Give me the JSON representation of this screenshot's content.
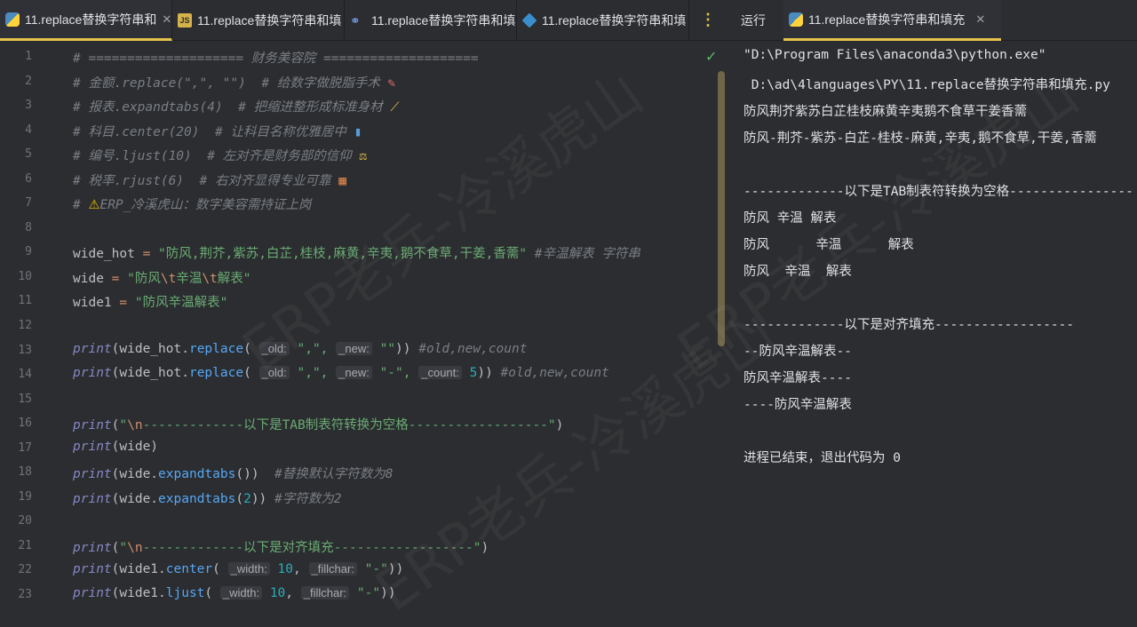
{
  "tabs": [
    {
      "label": "11.replace替换字符串和",
      "icon": "python-file-icon",
      "active": true
    },
    {
      "label": "11.replace替换字符串和填",
      "icon": "js-file-icon",
      "active": false
    },
    {
      "label": "11.replace替换字符串和填",
      "icon": "link-file-icon",
      "active": false
    },
    {
      "label": "11.replace替换字符串和填",
      "icon": "cube-file-icon",
      "active": false
    }
  ],
  "run_panel": {
    "title": "运行",
    "tab_label": "11.replace替换字符串和填充",
    "output": [
      "\"D:\\Program Files\\anaconda3\\python.exe\"",
      " D:\\ad\\4languages\\PY\\11.replace替换字符串和填充.py",
      "防风荆芥紫苏白芷桂枝麻黄辛夷鹅不食草干姜香薷",
      "防风-荆芥-紫苏-白芷-桂枝-麻黄,辛夷,鹅不食草,干姜,香薷",
      "",
      "-------------以下是TAB制表符转换为空格----------------",
      "防风 辛温 解表",
      "防风      辛温      解表",
      "防风  辛温  解表",
      "",
      "-------------以下是对齐填充------------------",
      "--防风辛温解表--",
      "防风辛温解表----",
      "----防风辛温解表",
      "",
      "进程已结束，退出代码为 0"
    ]
  },
  "editor": {
    "line_numbers": [
      "1",
      "2",
      "3",
      "4",
      "5",
      "6",
      "7",
      "8",
      "9",
      "10",
      "11",
      "12",
      "13",
      "14",
      "15",
      "16",
      "17",
      "18",
      "19",
      "20",
      "21",
      "22",
      "23"
    ],
    "comments": {
      "l1": "# ==================== 财务美容院 ====================",
      "l2": "# 金额.replace(\",\", \"\")  # 给数字做脱脂手术 ",
      "l3": "# 报表.expandtabs(4)  # 把缩进整形成标准身材 ",
      "l4": "# 科目.center(20)  # 让科目名称优雅居中 ",
      "l5": "# 编号.ljust(10)  # 左对齐是财务部的信仰 ",
      "l6": "# 税率.rjust(6)  # 右对齐显得专业可靠 ",
      "l7_prefix": "# ",
      "l7_text": "ERP_冷溪虎山：数字美容需持证上岗"
    },
    "l9": {
      "var": "wide_hot",
      "op": " = ",
      "str": "\"防风,荆芥,紫苏,白芷,桂枝,麻黄,辛夷,鹅不食草,干姜,香薷\"",
      "comment": " #辛温解表 字符串"
    },
    "l10": {
      "var": "wide",
      "op": " = ",
      "s1": "\"防风",
      "e1": "\\t",
      "s2": "辛温",
      "e2": "\\t",
      "s3": "解表\""
    },
    "l11": {
      "var": "wide1",
      "op": " = ",
      "str": "\"防风辛温解表\""
    },
    "l13": {
      "print": "print",
      "open": "(wide_hot.",
      "fn": "replace",
      "p": "( ",
      "h_old": "_old:",
      "a1": " \",\", ",
      "h_new": "_new:",
      "a2": " \"\"",
      "close": "))",
      "comment": " #old,new,count"
    },
    "l14": {
      "print": "print",
      "open": "(wide_hot.",
      "fn": "replace",
      "p": "( ",
      "h_old": "_old:",
      "a1": " \",\", ",
      "h_new": "_new:",
      "a2": " \"-\", ",
      "h_count": "_count:",
      "num": " 5",
      "close": "))",
      "comment": " #old,new,count"
    },
    "l16": {
      "print": "print",
      "p": "(",
      "s1": "\"",
      "esc": "\\n",
      "s2": "-------------以下是TAB制表符转换为空格------------------\"",
      "close": ")"
    },
    "l17": {
      "print": "print",
      "rest": "(wide)"
    },
    "l18": {
      "print": "print",
      "open": "(wide.",
      "fn": "expandtabs",
      "close": "())",
      "comment": "  #替换默认字符数为8"
    },
    "l19": {
      "print": "print",
      "open": "(wide.",
      "fn": "expandtabs",
      "p": "(",
      "num": "2",
      "close": "))",
      "comment": " #字符数为2"
    },
    "l21": {
      "print": "print",
      "p": "(",
      "s1": "\"",
      "esc": "\\n",
      "s2": "-------------以下是对齐填充------------------\"",
      "close": ")"
    },
    "l22": {
      "print": "print",
      "open": "(wide1.",
      "fn": "center",
      "p": "( ",
      "h_width": "_width:",
      "num": " 10",
      "comma": ", ",
      "h_fill": "_fillchar:",
      "str": " \"-\"",
      "close": "))"
    },
    "l23": {
      "print": "print",
      "open": "(wide1.",
      "fn": "ljust",
      "p": "( ",
      "h_width": "_width:",
      "num": " 10",
      "comma": ", ",
      "h_fill": "_fillchar:",
      "str": " \"-\"",
      "close": "))"
    }
  },
  "watermark": "ERP老兵-冷溪虎山"
}
